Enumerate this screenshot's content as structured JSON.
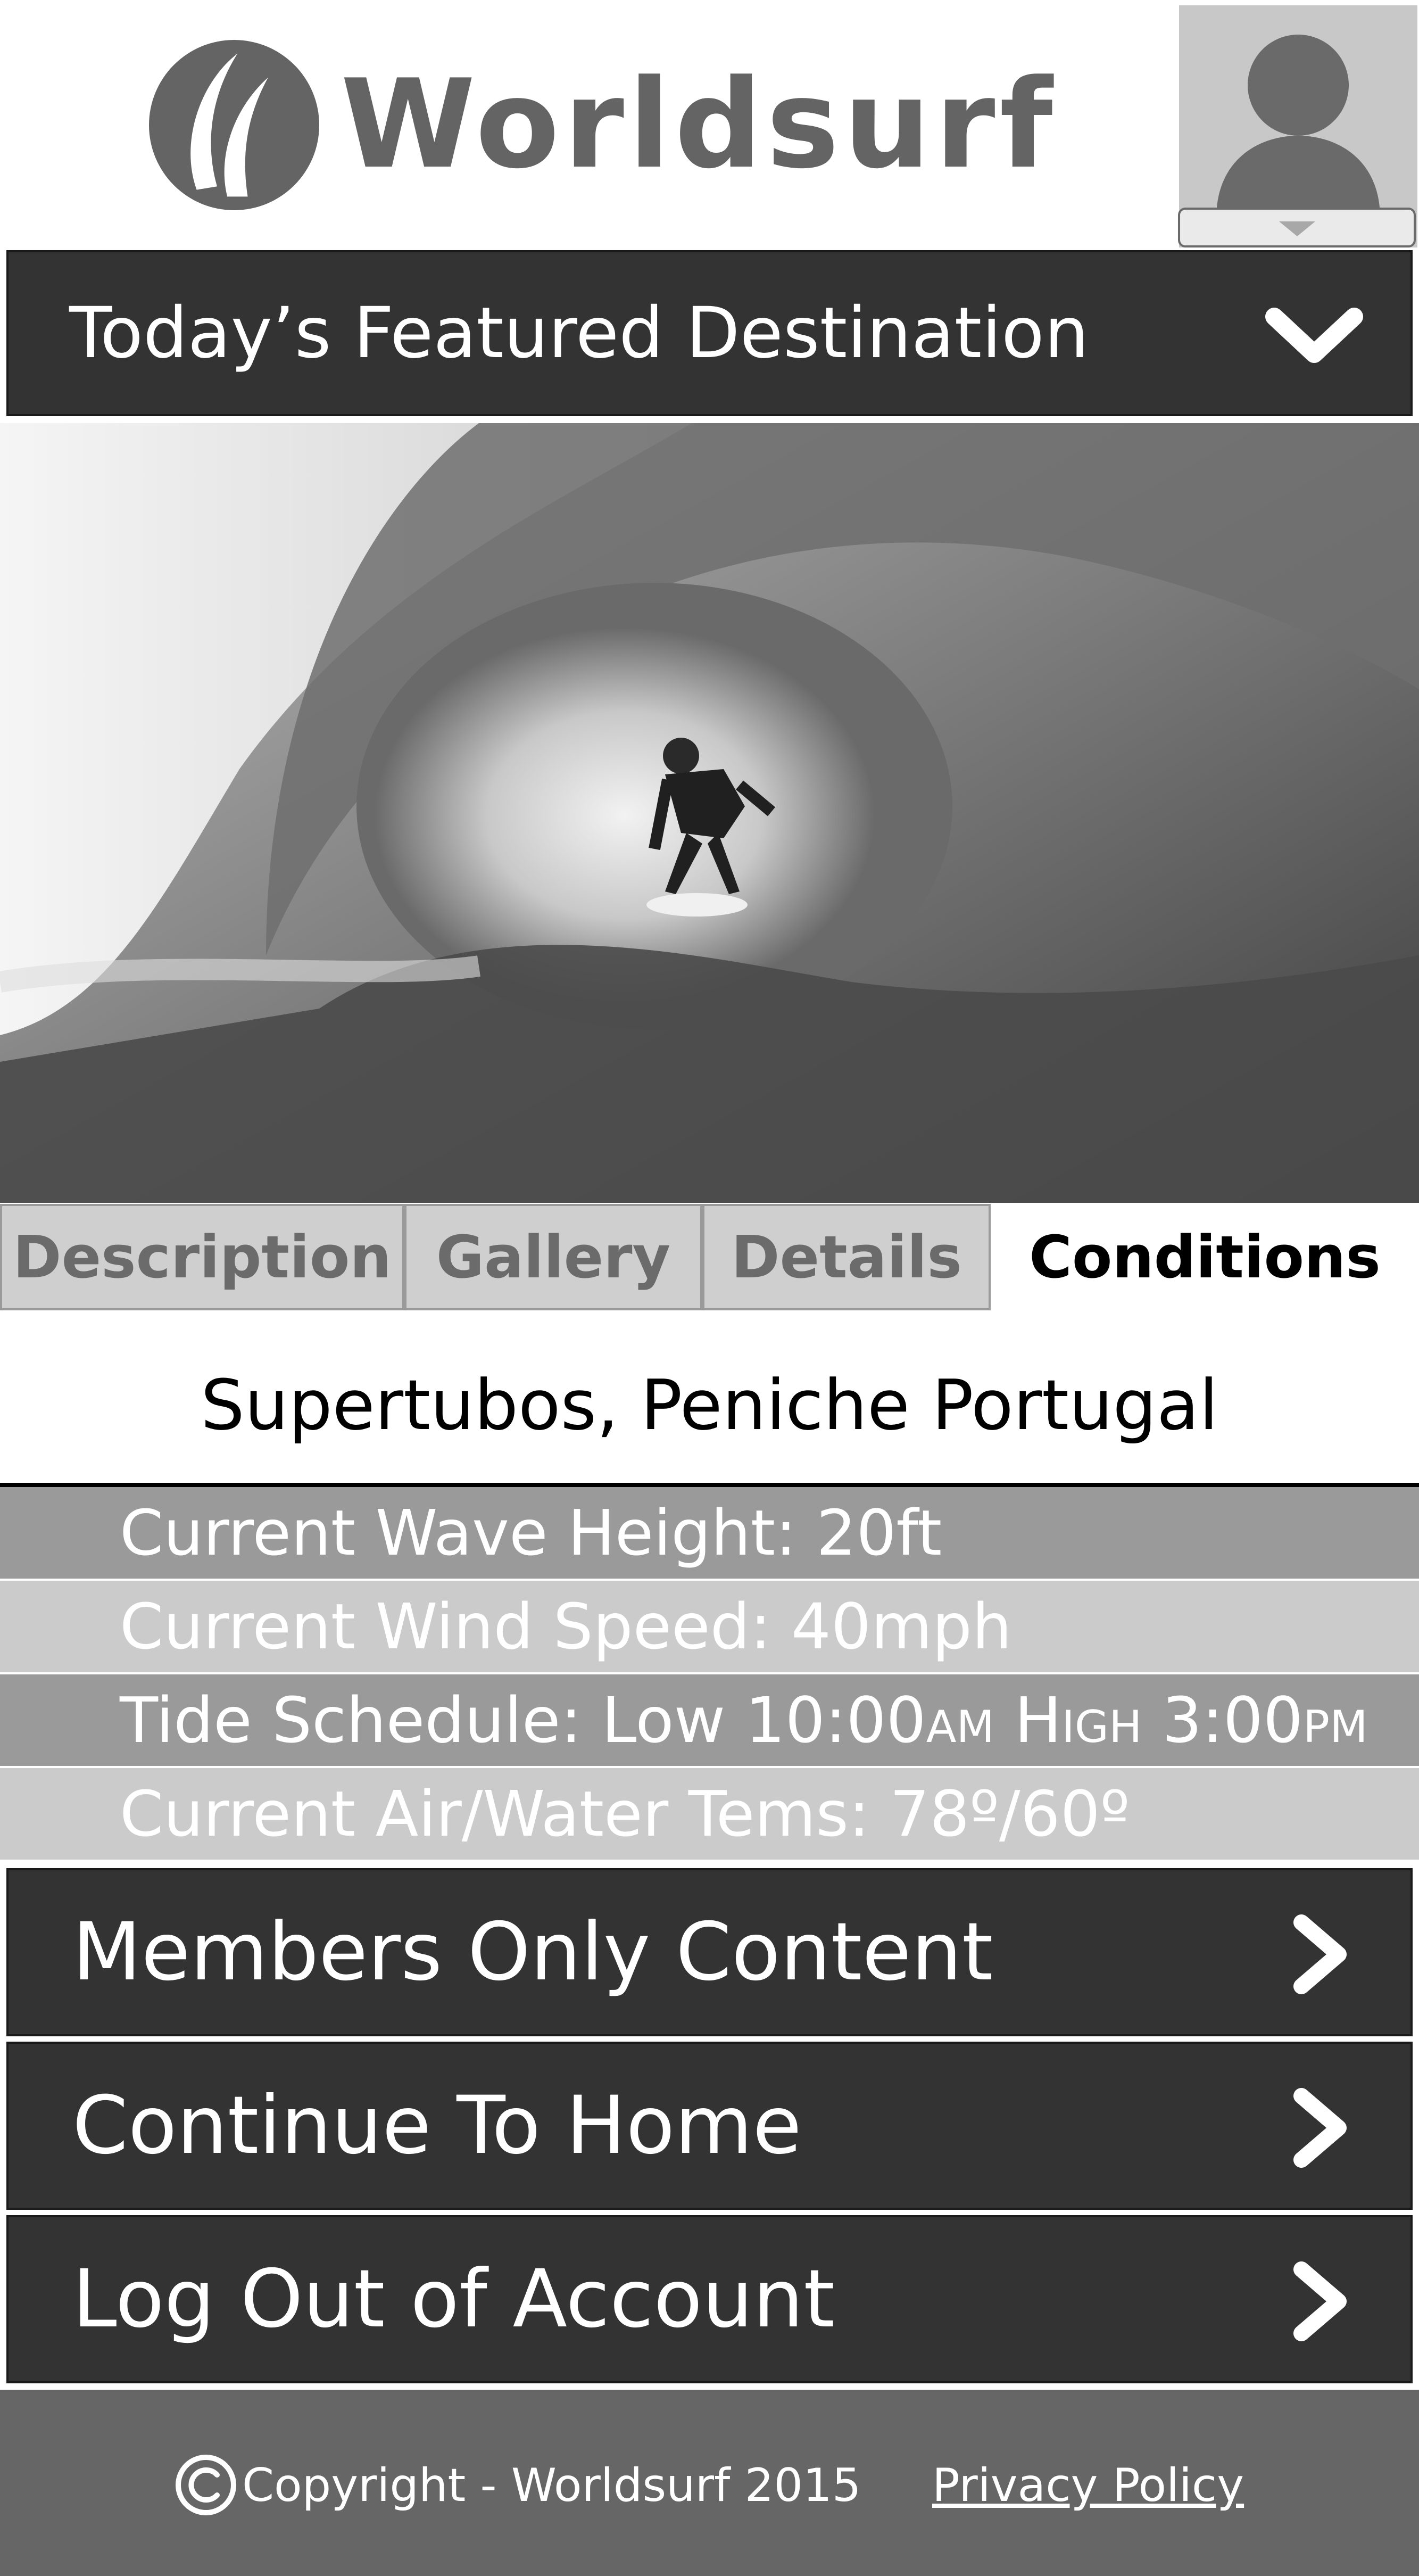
{
  "header": {
    "brand_name": "Worldsurf",
    "logo_icon": "wave-leaf-logo",
    "avatar_icon": "user-silhouette-icon",
    "avatar_dropdown_icon": "triangle-down-icon"
  },
  "featured": {
    "title": "Today’s Featured Destination",
    "toggle_icon": "chevron-down-icon"
  },
  "hero_image": {
    "subject": "surfer-in-barrel-wave-photo"
  },
  "tabs": [
    {
      "label": "Description",
      "active": false
    },
    {
      "label": "Gallery",
      "active": false
    },
    {
      "label": "Details",
      "active": false
    },
    {
      "label": "Conditions",
      "active": true
    }
  ],
  "location": "Supertubos, Peniche Portugal",
  "conditions": {
    "wave_height": "Current Wave Height: 20ft",
    "wind_speed": "Current Wind Speed: 40mph",
    "tide_prefix": "Tide Schedule: Low 10:00",
    "tide_am": "am",
    "tide_high_h": " H",
    "tide_high_rest": "igh",
    "tide_high_time": " 3:00",
    "tide_pm": "pm",
    "temps": "Current Air/Water Tems: 78º/60º"
  },
  "actions": [
    {
      "label": "Members Only Content",
      "icon": "chevron-right-icon"
    },
    {
      "label": "Continue To Home",
      "icon": "chevron-right-icon"
    },
    {
      "label": "Log Out of Account",
      "icon": "chevron-right-icon"
    }
  ],
  "footer": {
    "copyright": "Copyright - Worldsurf 2015",
    "copyright_icon": "copyright-icon",
    "privacy_link": "Privacy Policy"
  },
  "colors": {
    "dark_bar": "#333333",
    "footer": "#666666",
    "row_dark": "#9a9a9a",
    "row_light": "#cbcbcb",
    "tab_inactive": "#cfcfcf"
  }
}
